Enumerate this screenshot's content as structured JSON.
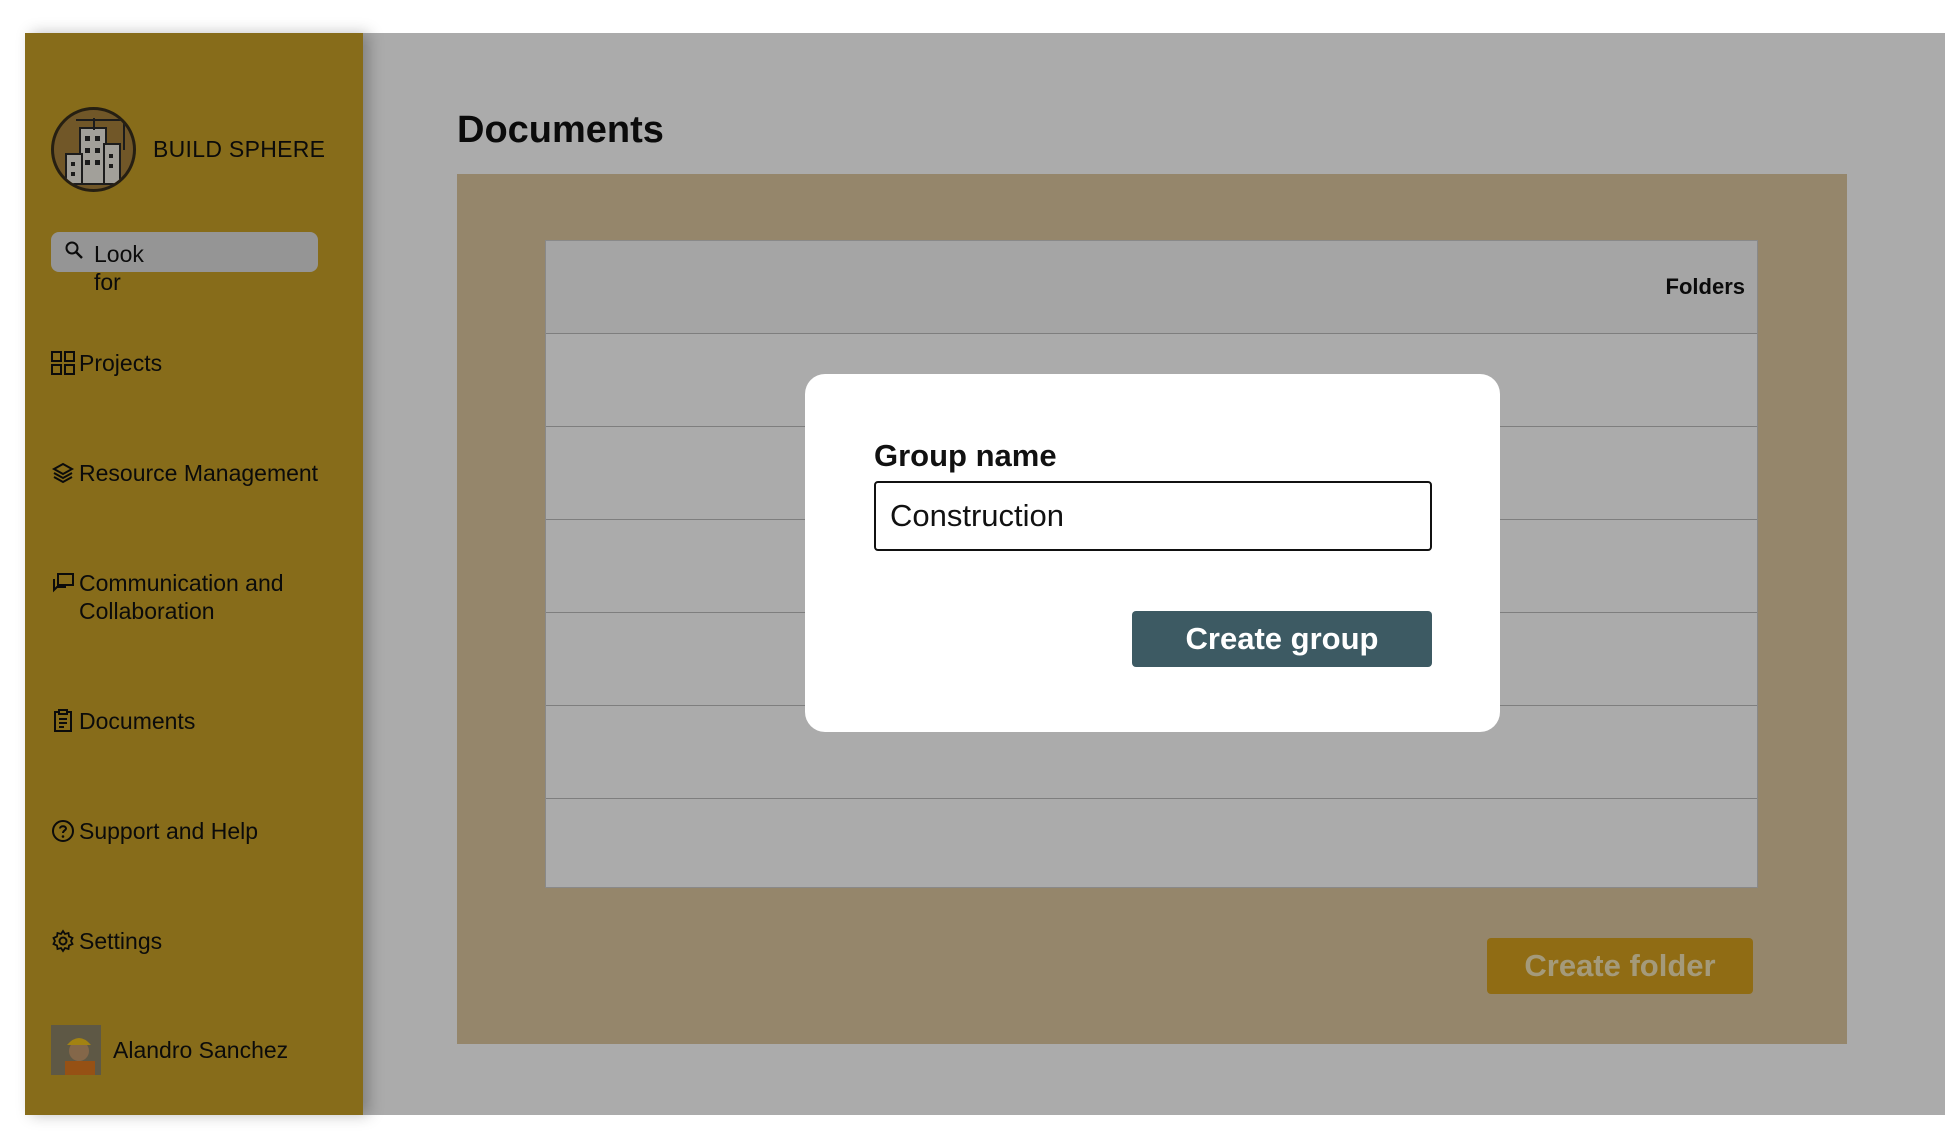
{
  "brand": {
    "name": "BUILD SPHERE"
  },
  "search": {
    "placeholder": "Look for"
  },
  "sidebar": {
    "items": [
      {
        "label": "Projects",
        "icon": "grid-icon"
      },
      {
        "label": "Resource Management",
        "icon": "layers-icon"
      },
      {
        "label": "Communication and Collaboration",
        "icon": "chat-icon"
      },
      {
        "label": "Documents",
        "icon": "clipboard-icon"
      },
      {
        "label": "Support and Help",
        "icon": "help-circle-icon"
      },
      {
        "label": "Settings",
        "icon": "gear-icon"
      }
    ]
  },
  "user": {
    "name": "Alandro Sanchez"
  },
  "main": {
    "title": "Documents",
    "table_header": "Folders",
    "create_folder_label": "Create folder"
  },
  "modal": {
    "label": "Group name",
    "input_value": "Construction",
    "button_label": "Create group"
  },
  "colors": {
    "sidebar": "#c9a227",
    "panel": "#dfc8a0",
    "primary_button": "#3d5a63",
    "accent_button": "#d7a21f"
  }
}
